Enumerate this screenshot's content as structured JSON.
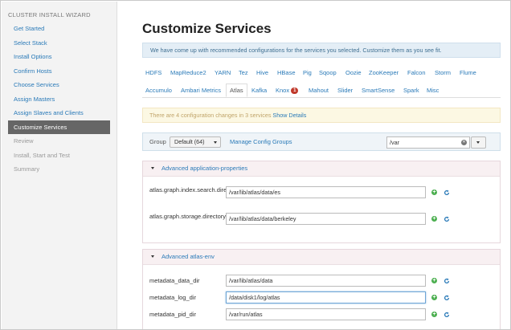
{
  "sidebar": {
    "title": "CLUSTER INSTALL WIZARD",
    "items": [
      {
        "label": "Get Started"
      },
      {
        "label": "Select Stack"
      },
      {
        "label": "Install Options"
      },
      {
        "label": "Confirm Hosts"
      },
      {
        "label": "Choose Services"
      },
      {
        "label": "Assign Masters"
      },
      {
        "label": "Assign Slaves and Clients"
      },
      {
        "label": "Customize Services"
      },
      {
        "label": "Review"
      },
      {
        "label": "Install, Start and Test"
      },
      {
        "label": "Summary"
      }
    ]
  },
  "main": {
    "title": "Customize Services",
    "info": "We have come up with recommended configurations for the services you selected. Customize them as you see fit.",
    "tabs_row1": [
      "HDFS",
      "MapReduce2",
      "YARN",
      "Tez",
      "Hive",
      "HBase",
      "Pig",
      "Sqoop",
      "Oozie",
      "ZooKeeper",
      "Falcon",
      "Storm",
      "Flume"
    ],
    "tabs_row2": [
      "Accumulo",
      "Ambari Metrics",
      "Atlas",
      "Kafka",
      "Knox",
      "Mahout",
      "Slider",
      "SmartSense",
      "Spark",
      "Misc"
    ],
    "active_tab": "Atlas",
    "knox_badge": "1",
    "warning": {
      "text": "There are 4 configuration changes in 3 services",
      "link": "Show Details"
    },
    "group": {
      "label": "Group",
      "selected": "Default (64)",
      "manage_link": "Manage Config Groups",
      "filter_value": "/var"
    },
    "sections": [
      {
        "title": "Advanced application-properties",
        "rows": [
          {
            "label": "atlas.graph.index.search.directory",
            "value": "/var/lib/atlas/data/es"
          },
          {
            "label": "atlas.graph.storage.directory",
            "value": "/var/lib/atlas/data/berkeley"
          }
        ]
      },
      {
        "title": "Advanced atlas-env",
        "rows": [
          {
            "label": "metadata_data_dir",
            "value": "/var/lib/atlas/data"
          },
          {
            "label": "metadata_log_dir",
            "value": "/data/disk1/log/atlas"
          },
          {
            "label": "metadata_pid_dir",
            "value": "/var/run/atlas"
          }
        ]
      }
    ]
  },
  "colors": {
    "link": "#2a7ab8",
    "active_nav_bg": "#666666",
    "badge": "#c0392b",
    "add_icon": "#4caf50"
  }
}
